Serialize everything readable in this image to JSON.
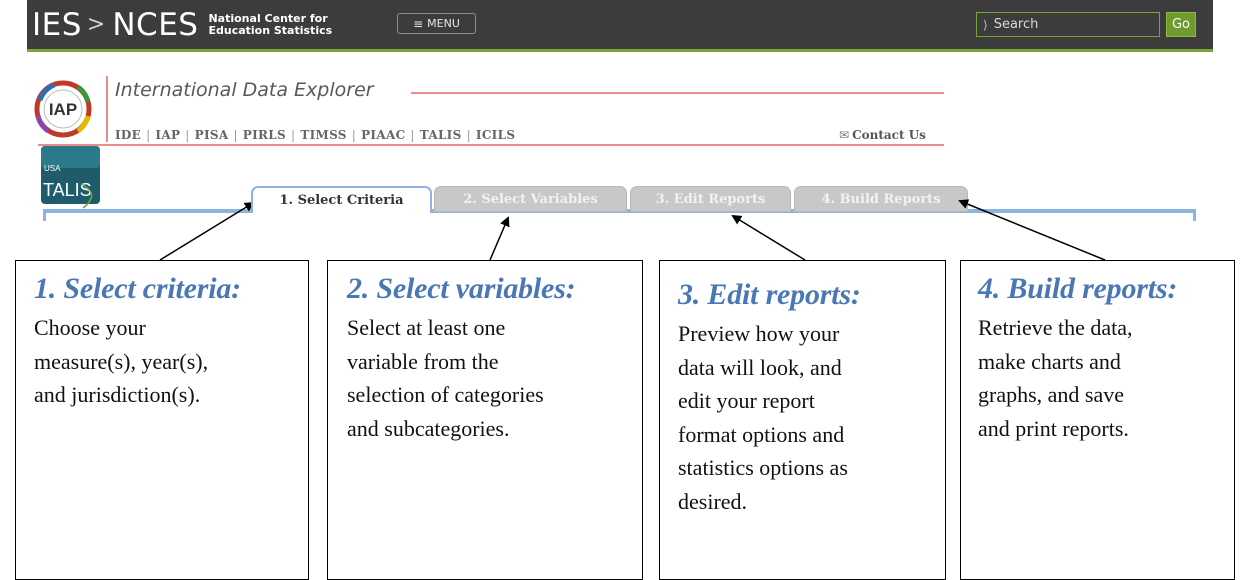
{
  "header": {
    "brand_ies": "IES",
    "brand_sep": ">",
    "brand_nces": "NCES",
    "brand_line1": "National Center for",
    "brand_line2": "Education Statistics",
    "menu_label": "MENU",
    "search_placeholder": "Search",
    "go_label": "Go"
  },
  "ide": {
    "logo_text": "IAP",
    "title": "International Data Explorer",
    "nav": [
      "IDE",
      "IAP",
      "PISA",
      "PIRLS",
      "TIMSS",
      "PIAAC",
      "TALIS",
      "ICILS"
    ],
    "contact_label": "Contact Us"
  },
  "talis_logo": {
    "country": "USA",
    "name": "TALIS"
  },
  "tabs": [
    {
      "label": "1. Select Criteria",
      "active": true
    },
    {
      "label": "2. Select Variables",
      "active": false
    },
    {
      "label": "3. Edit Reports",
      "active": false
    },
    {
      "label": "4. Build Reports",
      "active": false
    }
  ],
  "callouts": [
    {
      "title": "1. Select criteria:",
      "body": [
        "Choose your",
        "measure(s), year(s),",
        "and jurisdiction(s)."
      ]
    },
    {
      "title": "2. Select variables:",
      "body": [
        "Select at least one",
        "variable from the",
        "selection of categories",
        "and subcategories."
      ]
    },
    {
      "title": "3. Edit reports:",
      "body": [
        "Preview how your",
        "data will look, and",
        "edit your report",
        "format options and",
        "statistics options as",
        "desired."
      ]
    },
    {
      "title": "4. Build reports:",
      "body": [
        "Retrieve the data,",
        "make charts and",
        "graphs, and save",
        "and print reports."
      ]
    }
  ],
  "colors": {
    "topbar": "#3c3c3c",
    "accent_green": "#7aa53a",
    "ide_red": "#e88c8c",
    "tab_blue": "#8db3de",
    "callout_title": "#4a78b5"
  }
}
